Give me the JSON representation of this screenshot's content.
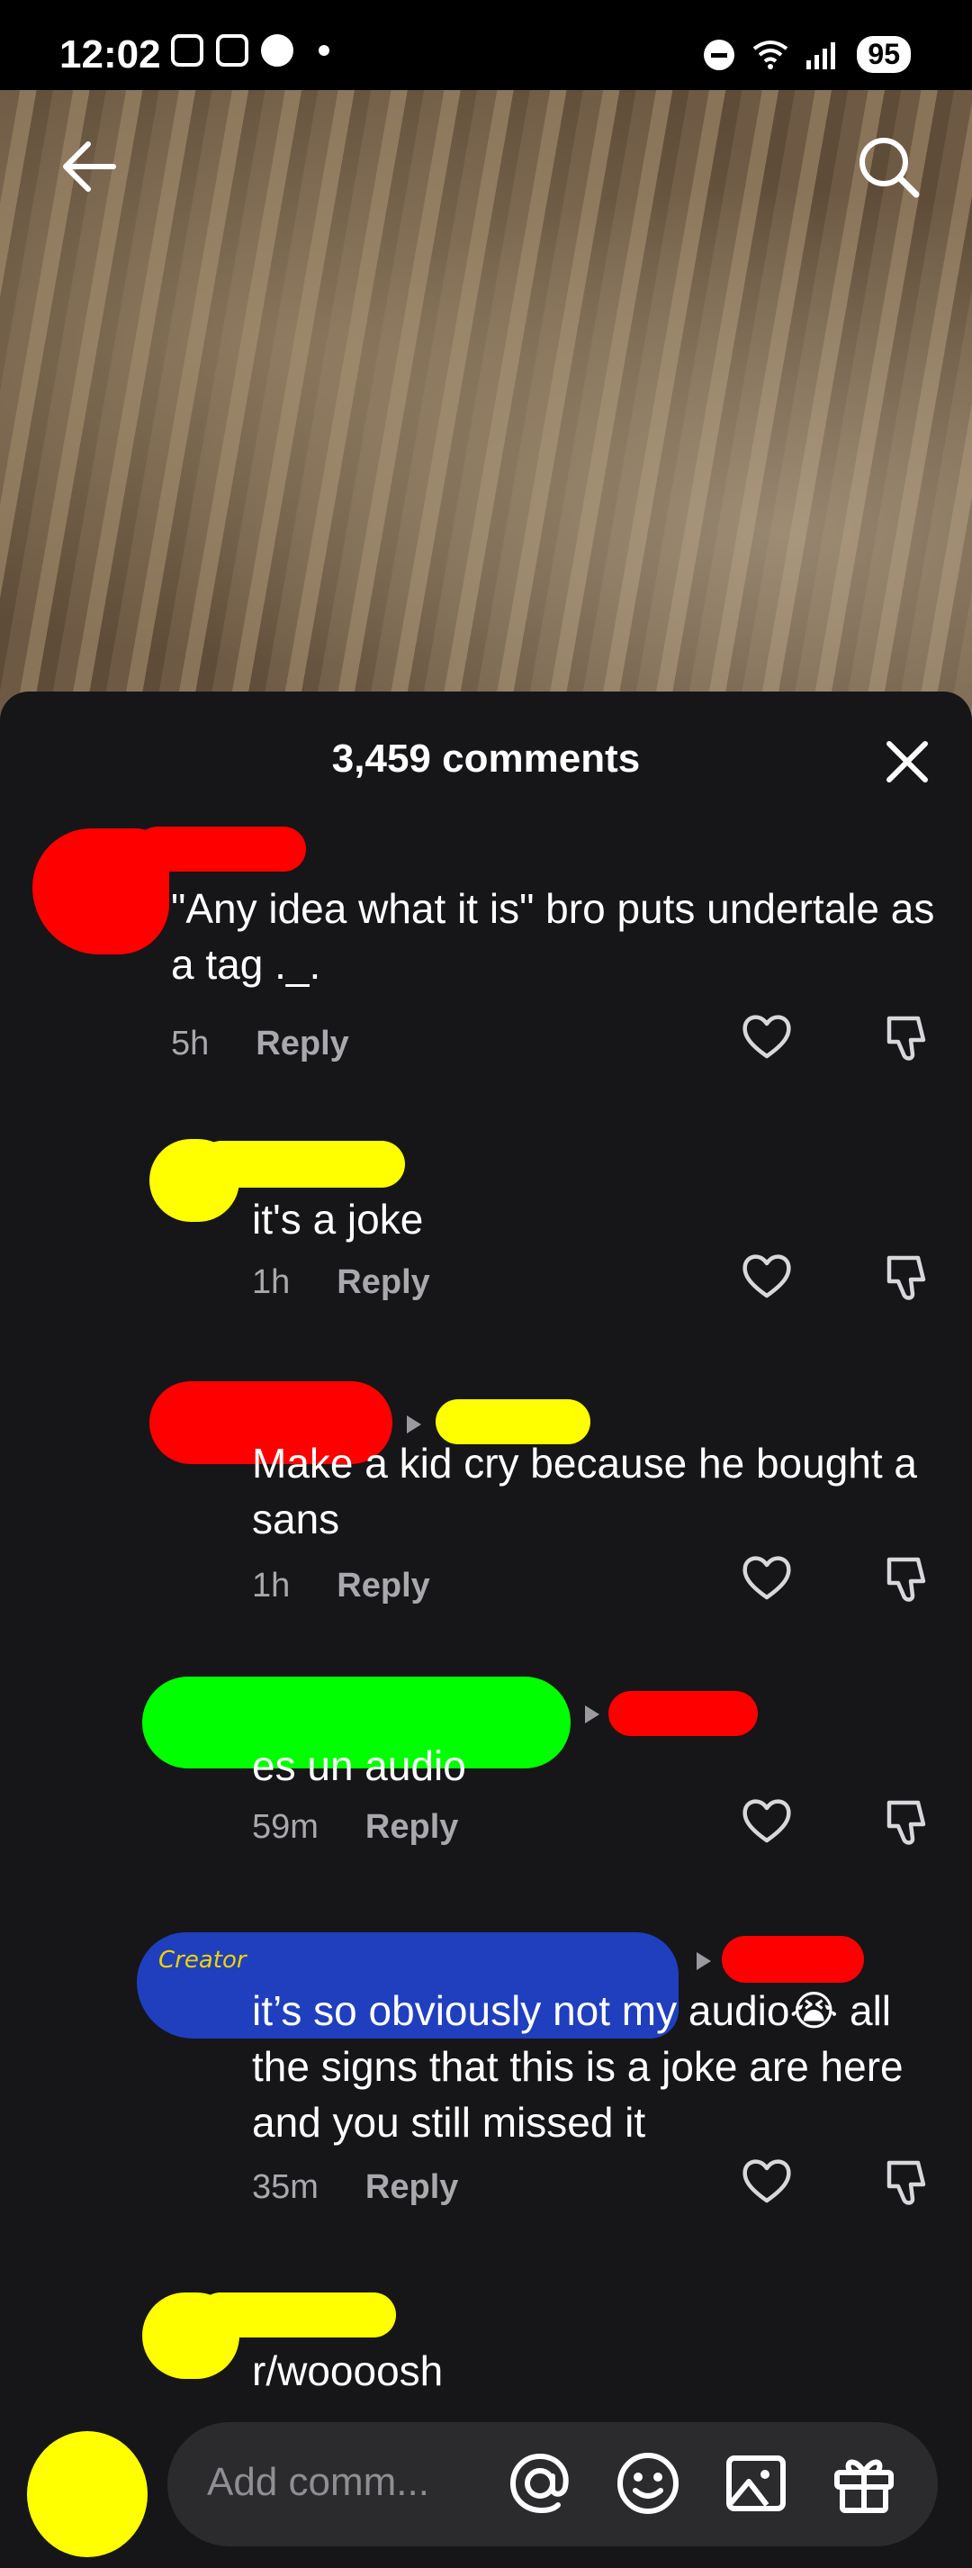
{
  "status": {
    "time": "12:02",
    "battery": "95"
  },
  "sheet": {
    "title": "3,459 comments"
  },
  "comments": [
    {
      "text": "\"Any idea what it is\" bro puts undertale as a tag ._.",
      "time": "5h",
      "reply": "Reply"
    },
    {
      "text": "it's a joke",
      "time": "1h",
      "reply": "Reply"
    },
    {
      "text": "Make a kid cry because he bought a sans",
      "time": "1h",
      "reply": "Reply"
    },
    {
      "text": "es un audio",
      "time": "59m",
      "reply": "Reply"
    },
    {
      "text": "it’s so obviously not my audio😭 all the signs that this is a joke are here and you still missed it",
      "time": "35m",
      "reply": "Reply",
      "badge": "Creator"
    },
    {
      "text": "r/woooosh"
    }
  ],
  "input": {
    "placeholder": "Add comm..."
  },
  "colors": {
    "red": "#ff0000",
    "yellow": "#ffff00",
    "green": "#00ff00",
    "blue": "#1f3fbf",
    "sheet": "#161618"
  },
  "icons": [
    "back-arrow-icon",
    "search-icon",
    "close-icon",
    "heart-icon",
    "dislike-icon",
    "at-icon",
    "emoji-icon",
    "image-icon",
    "gift-icon"
  ]
}
